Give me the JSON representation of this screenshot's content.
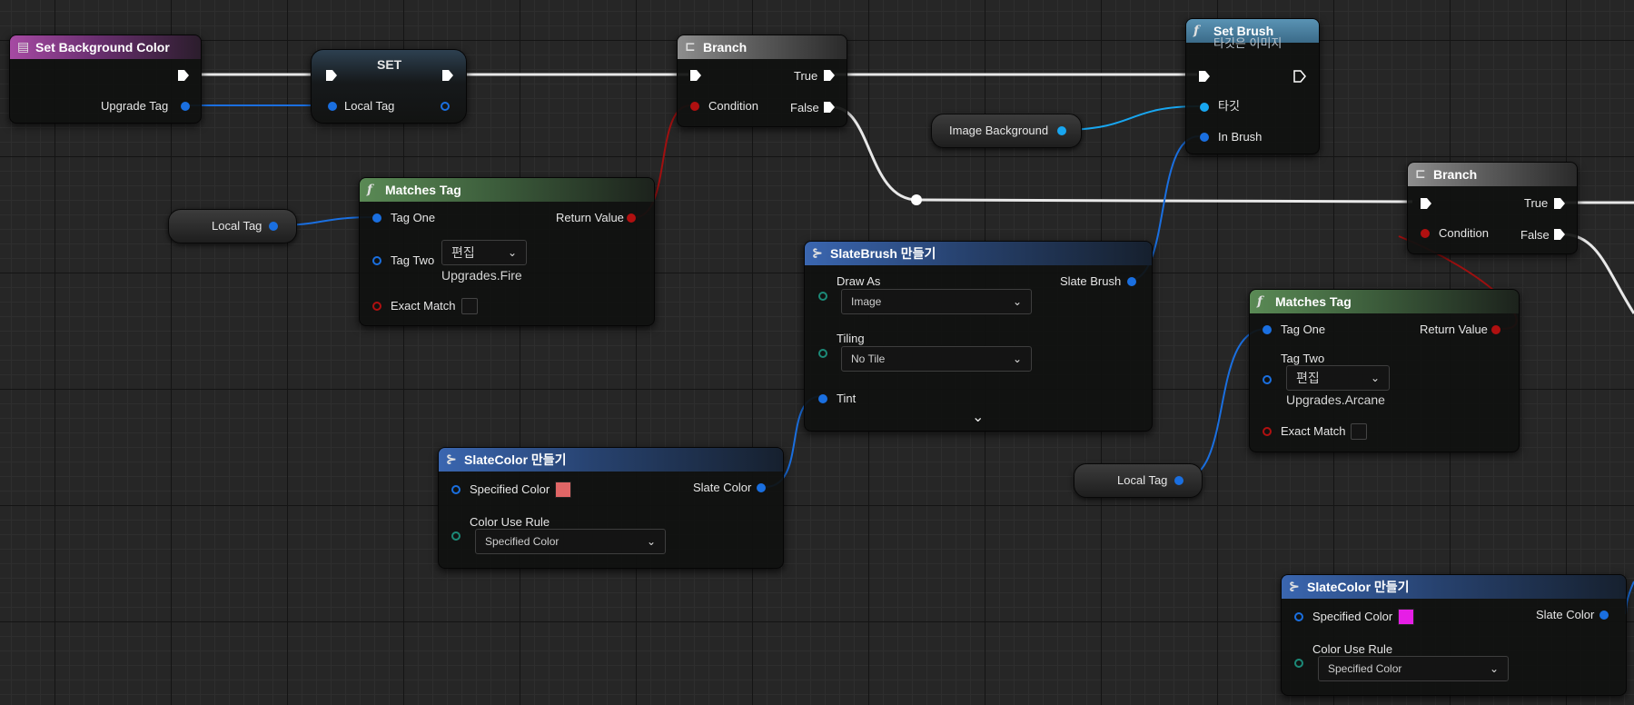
{
  "colors": {
    "accent_blue": "#1a6fe0",
    "exec": "#ffffff",
    "bool_red": "#b01010",
    "color_pin_teal": "#1c8a78",
    "swatch_red": "#e06666",
    "swatch_magenta": "#e61ee6"
  },
  "nodes": {
    "set_background_color": {
      "title": "Set Background Color",
      "upgrade_tag": "Upgrade Tag"
    },
    "set": {
      "title": "SET",
      "local_tag": "Local Tag"
    },
    "branch1": {
      "title": "Branch",
      "true": "True",
      "false": "False",
      "condition": "Condition"
    },
    "set_brush": {
      "title": "Set Brush",
      "subtitle": "타깃은 이미지",
      "target": "타깃",
      "in_brush": "In Brush"
    },
    "image_background": {
      "label": "Image Background"
    },
    "branch2": {
      "title": "Branch",
      "true": "True",
      "false": "False",
      "condition": "Condition"
    },
    "local_tag_var1": {
      "label": "Local Tag"
    },
    "matches_tag1": {
      "title": "Matches Tag",
      "tag_one": "Tag One",
      "tag_two": "Tag Two",
      "edit": "편집",
      "tag_value": "Upgrades.Fire",
      "return_value": "Return Value",
      "exact_match": "Exact Match"
    },
    "slatebrush": {
      "title": "SlateBrush 만들기",
      "draw_as": "Draw As",
      "draw_as_value": "Image",
      "tiling": "Tiling",
      "tiling_value": "No Tile",
      "tint": "Tint",
      "slate_brush": "Slate Brush",
      "expand": "⌄"
    },
    "matches_tag2": {
      "title": "Matches Tag",
      "tag_one": "Tag One",
      "tag_two": "Tag Two",
      "edit": "편집",
      "tag_value": "Upgrades.Arcane",
      "return_value": "Return Value",
      "exact_match": "Exact Match"
    },
    "local_tag_var2": {
      "label": "Local Tag"
    },
    "slatecolor1": {
      "title": "SlateColor 만들기",
      "specified_color": "Specified Color",
      "slate_color": "Slate Color",
      "color_use_rule": "Color Use Rule",
      "rule_value": "Specified Color"
    },
    "slatecolor2": {
      "title": "SlateColor 만들기",
      "specified_color": "Specified Color",
      "slate_color": "Slate Color",
      "color_use_rule": "Color Use Rule",
      "rule_value": "Specified Color"
    }
  },
  "icons": {
    "function": "f",
    "branch": "⊏",
    "make": "⊱",
    "chevron": "⌄"
  }
}
